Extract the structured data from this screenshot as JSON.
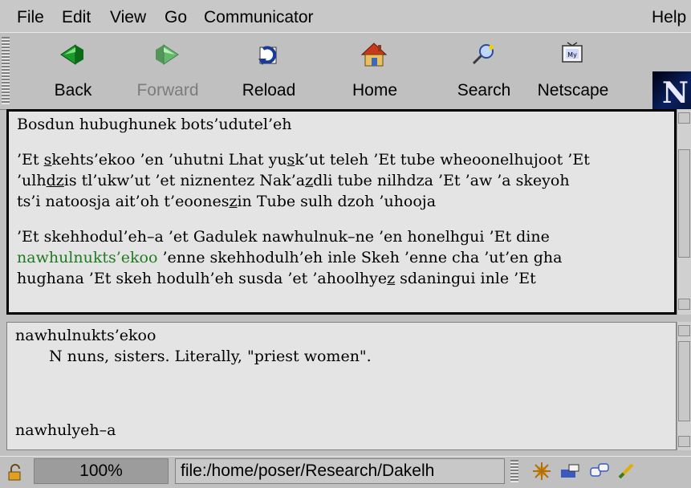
{
  "menubar": {
    "items": [
      "File",
      "Edit",
      "View",
      "Go",
      "Communicator"
    ],
    "help": "Help"
  },
  "toolbar": {
    "buttons": [
      {
        "label": "Back",
        "icon": "back-arrow-icon",
        "enabled": true
      },
      {
        "label": "Forward",
        "icon": "forward-arrow-icon",
        "enabled": false
      },
      {
        "label": "Reload",
        "icon": "reload-icon",
        "enabled": true
      },
      {
        "label": "Home",
        "icon": "home-icon",
        "enabled": true
      },
      {
        "label": "Search",
        "icon": "search-icon",
        "enabled": true
      },
      {
        "label": "Netscape",
        "icon": "my-netscape-icon",
        "enabled": true
      }
    ],
    "logo_letter": "N"
  },
  "content": {
    "title_line": "Bosdun hubughunek bots’udutel’eh",
    "p1": {
      "l1_a": "’Et ",
      "l1_u1": "s",
      "l1_b": "kehts’ekoo ’en ’uhutni Lhat yu",
      "l1_u2": "s",
      "l1_c": "k’ut teleh ’Et tube wheoonelhujoot ’Et",
      "l2_a": "’ulh",
      "l2_u1": "dz",
      "l2_b": "is tl’ukw’ut ’et niznentez Nak’a",
      "l2_u2": "z",
      "l2_c": "dli tube nilhdza ’Et ’aw ’a skeyoh",
      "l3_a": "ts’i natoosja ait’oh t’eoones",
      "l3_u1": "z",
      "l3_b": "in Tube sulh dzoh ’uhooja"
    },
    "p2": {
      "l1": "’Et skehhodul’eh–a ’et Gadulek nawhulnuk–ne ’en honelhgui ’Et dine",
      "l2_link": "nawhulnukts’ekoo",
      "l2_rest": " ’enne skehhodulh’eh inle Skeh ’enne cha ’ut’en gha",
      "l3_a": "hughana ’Et skeh hodulh’eh susda ’et ’ahoolhye",
      "l3_u1": "z",
      "l3_b": " sdaningui inle ’Et"
    }
  },
  "definitions": {
    "entries": [
      {
        "word": "nawhulnukts’ekoo",
        "gloss": "N nuns, sisters. Literally, \"priest women\"."
      },
      {
        "word": "nawhulyeh–a",
        "gloss": ""
      }
    ]
  },
  "statusbar": {
    "zoom": "100%",
    "url": "file:/home/poser/Research/Dakelh"
  },
  "colors": {
    "link": "#1f7a1f",
    "frame_bg": "#e4e4e4",
    "chrome": "#c0c0c0"
  }
}
